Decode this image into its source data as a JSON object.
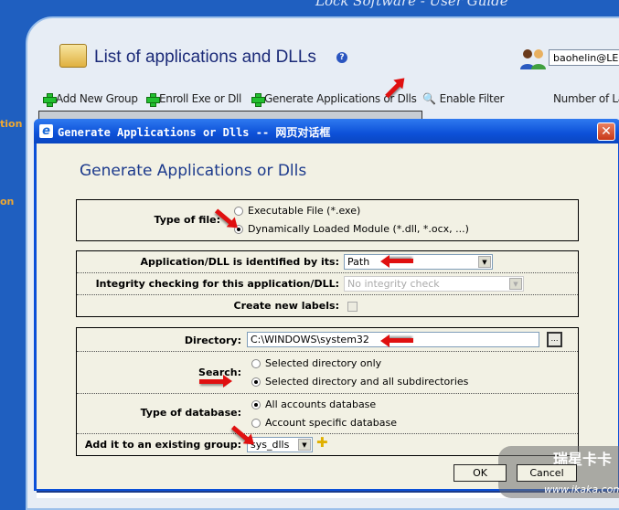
{
  "header": {
    "banner_text": "Lock Software - User Guide",
    "page_title": "List of applications and DLLs",
    "user_field": "baohelin@LE"
  },
  "sidebar": {
    "item1": "tion",
    "item2": "on"
  },
  "toolbar": {
    "add_group": "Add New Group",
    "enroll": "Enroll Exe or Dll",
    "generate": "Generate Applications or Dlls",
    "filter": "Enable Filter",
    "number_label": "Number of La"
  },
  "dialog": {
    "window_title": "Generate Applications or Dlls -- 网页对话框",
    "heading": "Generate Applications or Dlls",
    "type_of_file": {
      "label": "Type of file:",
      "options": [
        "Executable File (*.exe)",
        "Dynamically Loaded Module (*.dll, *.ocx, ...)"
      ],
      "selected": 1
    },
    "identified_by": {
      "label": "Application/DLL is identified by its:",
      "value": "Path"
    },
    "integrity": {
      "label": "Integrity checking for this application/DLL:",
      "value": "No integrity check"
    },
    "create_labels": {
      "label": "Create new labels:",
      "checked": false
    },
    "directory": {
      "label": "Directory:",
      "value": "C:\\WINDOWS\\system32"
    },
    "search": {
      "label": "Search:",
      "options": [
        "Selected directory only",
        "Selected directory and all subdirectories"
      ],
      "selected": 1
    },
    "database": {
      "label": "Type of database:",
      "options": [
        "All accounts database",
        "Account specific database"
      ],
      "selected": 0
    },
    "group": {
      "label": "Add it to an existing group:",
      "value": "sys_dlls"
    },
    "ok": "OK",
    "cancel": "Cancel"
  },
  "watermark": {
    "line1": "瑞星卡卡",
    "line2": "www.ikaka.com"
  },
  "colors": {
    "arrow": "#e01010",
    "title_blue": "#1c3a8c",
    "dialog_bg": "#f2f1e4"
  }
}
